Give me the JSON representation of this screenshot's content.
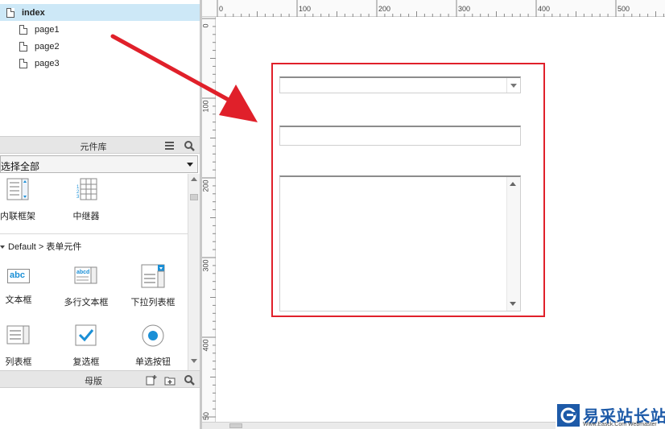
{
  "pages": [
    {
      "label": "index",
      "selected": true
    },
    {
      "label": "page1",
      "selected": false
    },
    {
      "label": "page2",
      "selected": false
    },
    {
      "label": "page3",
      "selected": false
    }
  ],
  "library": {
    "title": "元件库",
    "select_value": "选择全部",
    "widgets_top": [
      {
        "label": "内联框架",
        "icon": "inline-frame-icon"
      },
      {
        "label": "中继器",
        "icon": "repeater-icon"
      }
    ],
    "section_title": "Default > 表单元件",
    "widgets_form": [
      {
        "label": "文本框",
        "icon": "text-field-icon",
        "icon_text": "abc"
      },
      {
        "label": "多行文本框",
        "icon": "text-area-icon",
        "icon_text": "abcd"
      },
      {
        "label": "下拉列表框",
        "icon": "droplist-icon"
      },
      {
        "label": "列表框",
        "icon": "list-box-icon"
      },
      {
        "label": "复选框",
        "icon": "checkbox-icon"
      },
      {
        "label": "单选按钮",
        "icon": "radio-button-icon"
      }
    ]
  },
  "masters": {
    "title": "母版"
  },
  "ruler": {
    "top_labels": [
      "0",
      "100",
      "200",
      "300",
      "400",
      "500"
    ],
    "left_labels": [
      "0",
      "100",
      "200",
      "300",
      "400",
      "50"
    ]
  },
  "watermark": {
    "title": "易采站长站",
    "subtitle": "Www.Easck.Com Webmaster"
  },
  "colors": {
    "accent": "#e0202a",
    "selection": "#cde8f7",
    "brand": "#1d5aa8",
    "icon_blue": "#1a8fd6"
  }
}
